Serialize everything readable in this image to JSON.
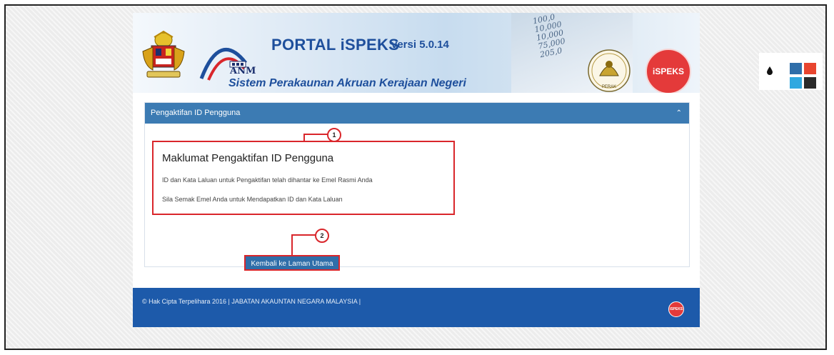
{
  "header": {
    "title": "PORTAL iSPEKS",
    "version": "versi 5.0.14",
    "subtitle": "Sistem Perakaunan Akruan Kerajaan Negeri",
    "anm_label": "ANM",
    "perak_label": "PERAK",
    "ispeks_logo_text": "iSPEKS",
    "banner_numbers": [
      "100,0",
      "10,000",
      "10,000",
      "75,000",
      "205,0"
    ]
  },
  "panel": {
    "title": "Pengaktifan ID Pengguna",
    "collapse_icon": "chevron-up-icon",
    "info_title": "Maklumat Pengaktifan ID Pengguna",
    "info_line1": "ID dan Kata Laluan untuk Pengaktifan telah dihantar ke Emel Rasmi Anda",
    "info_line2": "Sila Semak Emel Anda untuk Mendapatkan ID dan Kata Laluan",
    "back_button": "Kembali ke Laman Utama"
  },
  "annotations": {
    "marker1": "1",
    "marker2": "2"
  },
  "footer": {
    "text": "© Hak Cipta Terpelihara 2016 | JABATAN AKAUNTAN NEGARA MALAYSIA |",
    "logo_text": "iSPEKS"
  },
  "theme": {
    "icon": "drop-icon",
    "swatches": [
      "#2f6ea9",
      "#e8452f",
      "#2fa8e0",
      "#2b2b2b"
    ]
  }
}
